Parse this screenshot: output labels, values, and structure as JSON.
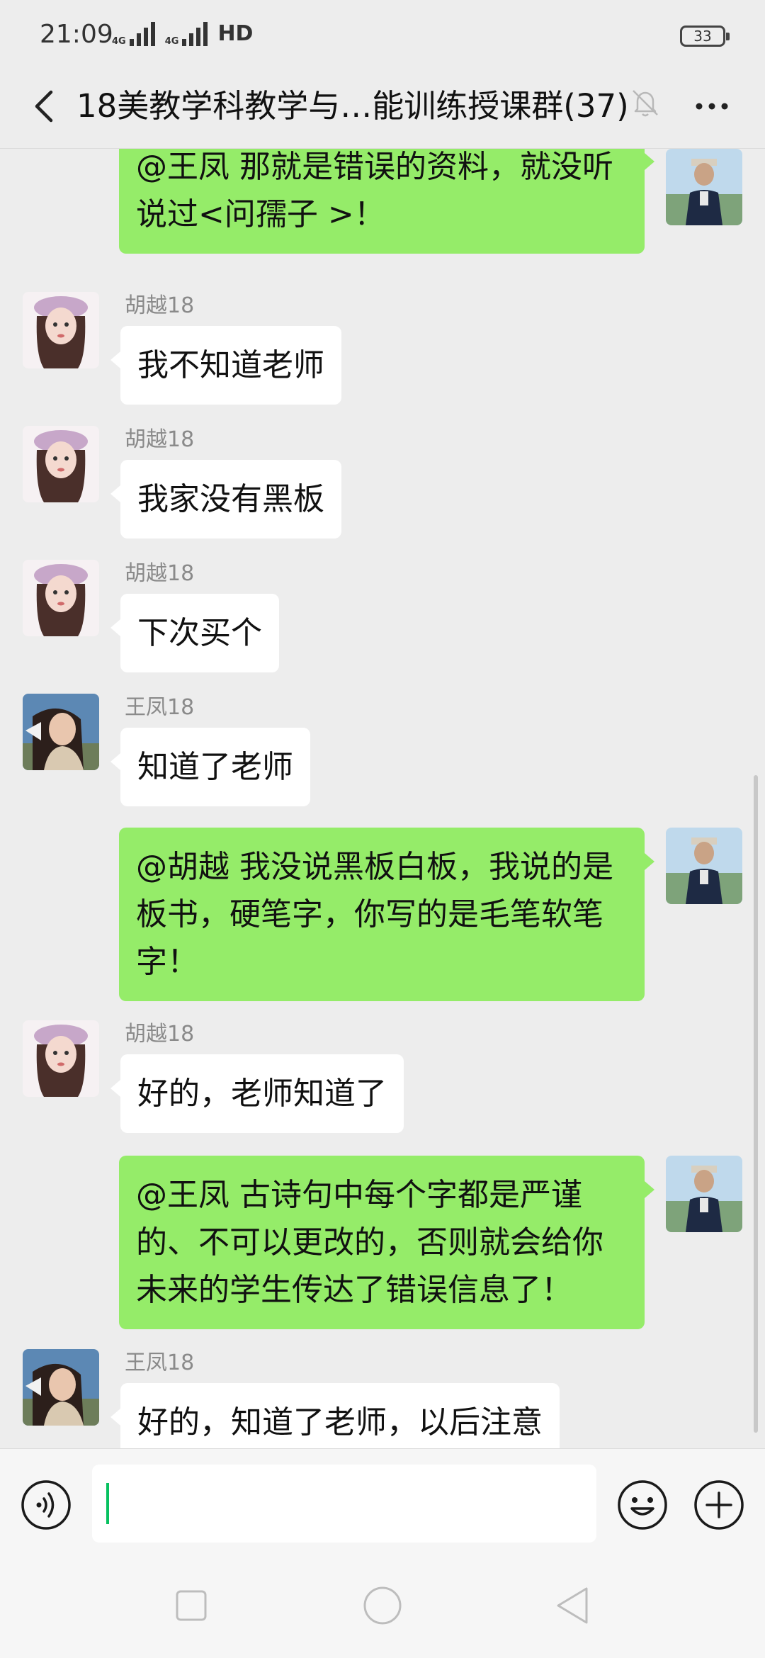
{
  "status_bar": {
    "time": "21:09",
    "network": "4G",
    "hd": "HD",
    "battery": "33"
  },
  "header": {
    "title": "18美教学科教学与…能训练授课群(37)"
  },
  "messages": [
    {
      "direction": "out",
      "text": "@王凤 那就是错误的资料，就没听说过<问孺子 >！"
    },
    {
      "direction": "in",
      "sender": "胡越18",
      "text": "我不知道老师"
    },
    {
      "direction": "in",
      "sender": "胡越18",
      "text": "我家没有黑板"
    },
    {
      "direction": "in",
      "sender": "胡越18",
      "text": "下次买个"
    },
    {
      "direction": "in",
      "sender": "王凤18",
      "text": "知道了老师"
    },
    {
      "direction": "out",
      "text": "@胡越  我没说黑板白板，我说的是板书，硬笔字，你写的是毛笔软笔字！"
    },
    {
      "direction": "in",
      "sender": "胡越18",
      "text": "好的，老师知道了"
    },
    {
      "direction": "out",
      "text": "@王凤  古诗句中每个字都是严谨的、不可以更改的，否则就会给你未来的学生传达了错误信息了！"
    },
    {
      "direction": "in",
      "sender": "王凤18",
      "text": "好的，知道了老师，以后注意"
    }
  ],
  "input": {
    "value": "",
    "placeholder": ""
  },
  "icons": {
    "back": "back-arrow-icon",
    "mute": "bell-muted-icon",
    "more": "more-dots-icon",
    "voice": "voice-icon",
    "emoji": "emoji-icon",
    "plus": "plus-icon"
  },
  "colors": {
    "outgoing_bubble": "#95ec69",
    "incoming_bubble": "#ffffff",
    "background": "#ededed",
    "cursor": "#07c160"
  }
}
